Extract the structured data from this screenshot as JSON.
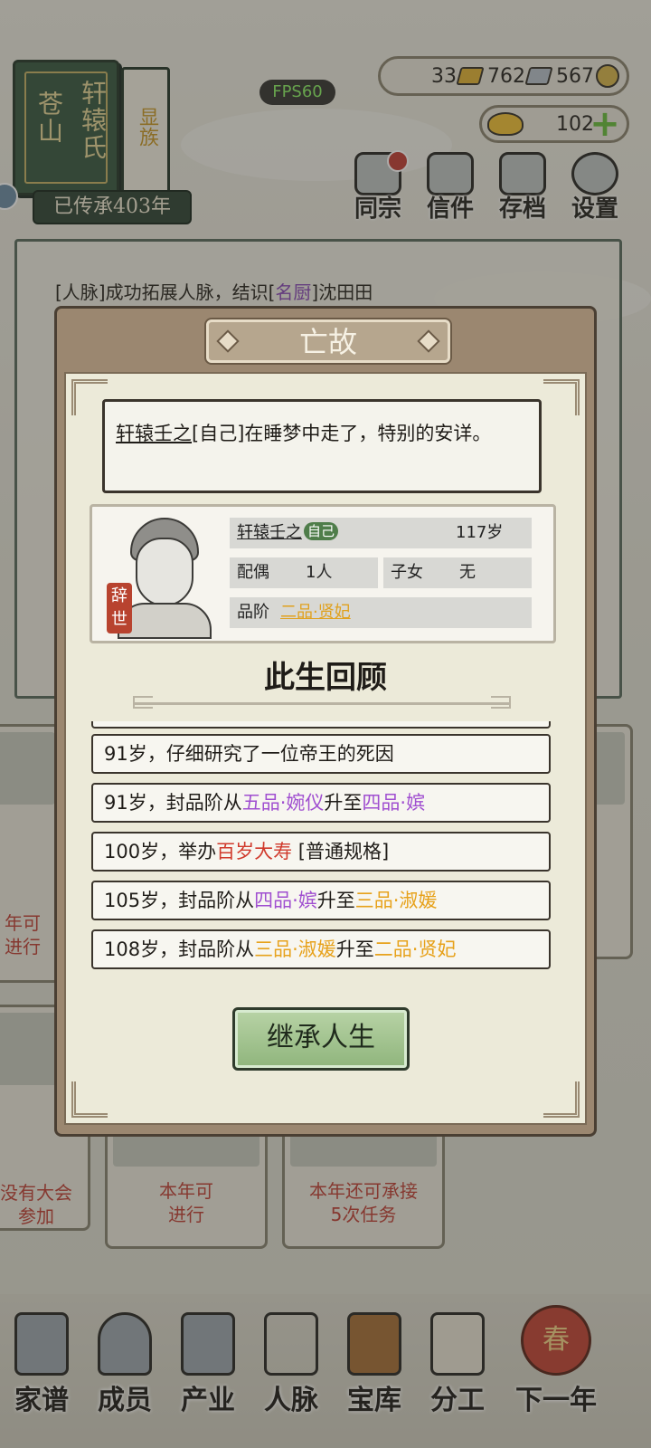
{
  "header": {
    "clan_mountain": "苍山",
    "clan_surname": "轩辕氏",
    "clan_sub": "显族",
    "inherit_text": "已传承403年",
    "fps": "FPS60"
  },
  "resources": {
    "gold": "33",
    "silver": "762",
    "coin": "567",
    "ingot": "102"
  },
  "top_menu": [
    {
      "label": "同宗",
      "icon": "clan-book-icon"
    },
    {
      "label": "信件",
      "icon": "letter-icon"
    },
    {
      "label": "存档",
      "icon": "scroll-brush-icon"
    },
    {
      "label": "设置",
      "icon": "gear-icon"
    }
  ],
  "log": [
    "[人脉]成功拓展人脉，结识[名厨]沈田田"
  ],
  "log_partial": {
    "prefix": "[人脉]成功拓展人脉，结识[",
    "highlight": "名厨",
    "suffix": "]沈田田"
  },
  "cards": {
    "left_top": [
      "年可",
      "进行"
    ],
    "left_bottom": [
      "没有大会",
      "参加"
    ],
    "middle": [
      "本年可",
      "进行"
    ],
    "right": [
      "本年还可承接",
      "5次任务"
    ]
  },
  "bottom_nav": [
    {
      "label": "家谱",
      "icon": "genealogy-book-icon"
    },
    {
      "label": "成员",
      "icon": "member-icon"
    },
    {
      "label": "产业",
      "icon": "building-icon"
    },
    {
      "label": "人脉",
      "icon": "network-icon"
    },
    {
      "label": "宝库",
      "icon": "treasure-box-icon"
    },
    {
      "label": "分工",
      "icon": "scroll-icon"
    },
    {
      "label": "下一年",
      "icon": "lantern-icon",
      "icon_text": "春"
    }
  ],
  "dialog": {
    "title": "亡故",
    "message_name": "轩辕壬之",
    "message_rest": "[自己]在睡梦中走了，特别的安详。",
    "profile": {
      "seal": "辞世",
      "name": "轩辕壬之",
      "self_badge": "自己",
      "age": "117岁",
      "spouse_label": "配偶",
      "spouse_value": "1人",
      "children_label": "子女",
      "children_value": "无",
      "rank_label": "品阶",
      "rank_value": "二品·贤妃"
    },
    "review_title": "此生回顾",
    "events": [
      {
        "pre": "91岁，仔细研究了一位帝王的死因"
      },
      {
        "pre": "91岁，封品阶从",
        "a": "五品·婉仪",
        "mid": "升至",
        "b": "四品·嫔"
      },
      {
        "pre": "100岁，举办",
        "c": "百岁大寿",
        "post": " [普通规格]"
      },
      {
        "pre": "105岁，封品阶从",
        "a": "四品·嫔",
        "mid": "升至",
        "b": "三品·淑媛"
      },
      {
        "pre": "108岁，封品阶从",
        "a": "三品·淑媛",
        "mid": "升至",
        "b": "二品·贤妃"
      }
    ],
    "inherit_button": "继承人生"
  },
  "colors": {
    "purple_rank": "#a04fd0",
    "orange_rank": "#e7a21c",
    "red_highlight": "#d03a2c",
    "button_green": "#8fb57c"
  }
}
